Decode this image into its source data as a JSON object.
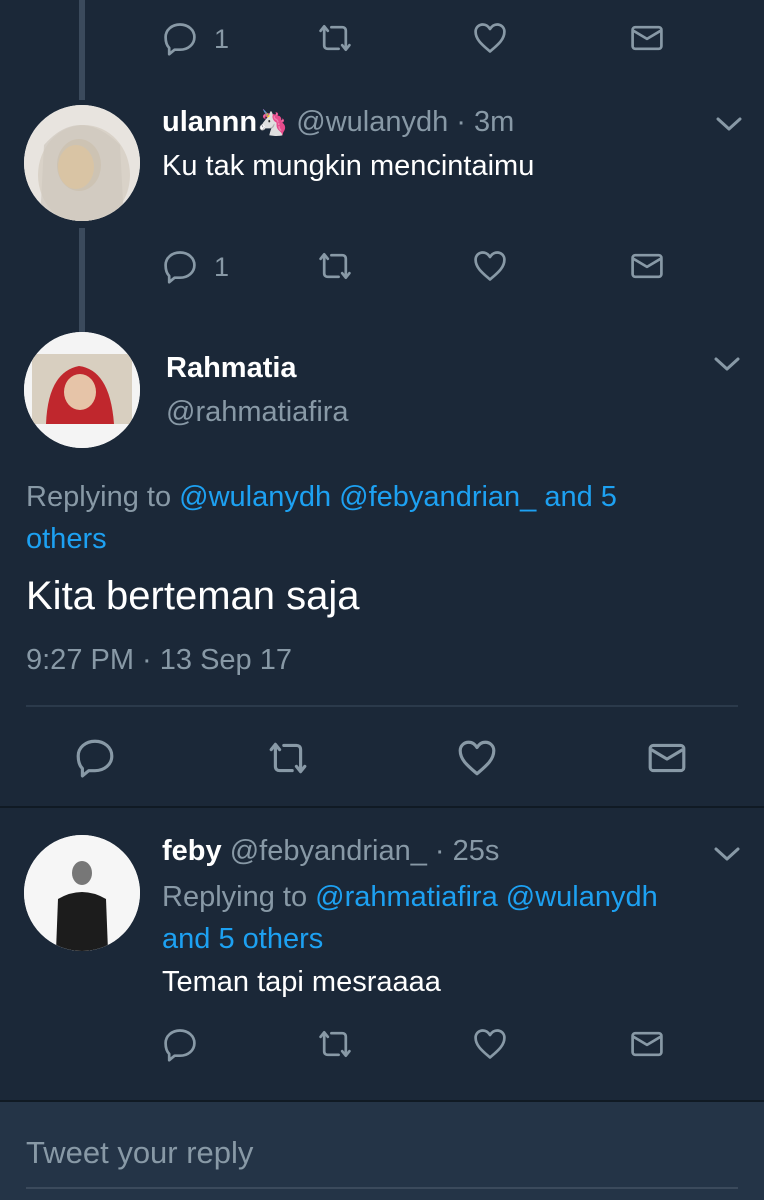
{
  "colors": {
    "background": "#1b2838",
    "accent": "#1da1f2",
    "muted": "#8899a6",
    "text": "#ffffff"
  },
  "tweet0": {
    "reply_count": "1"
  },
  "tweet1": {
    "name": "ulannn",
    "name_emoji": "🦄",
    "handle": "@wulanydh",
    "time": "· 3m",
    "text": "Ku tak mungkin mencintaimu",
    "reply_count": "1"
  },
  "main": {
    "name": "Rahmatia",
    "handle": "@rahmatiafira",
    "replying_prefix": "Replying to",
    "replying_mentions": "@wulanydh @febyandrian_ and 5",
    "replying_others": "others",
    "text": "Kita berteman saja",
    "timestamp": "9:27 PM · 13 Sep 17"
  },
  "tweet3": {
    "name": "feby",
    "handle": "@febyandrian_",
    "time": "· 25s",
    "replying_prefix": "Replying to",
    "replying_mentions": "@rahmatiafira @wulanydh",
    "replying_others": "and 5 others",
    "text": "Teman tapi mesraaaa"
  },
  "reply_box": {
    "placeholder": "Tweet your reply"
  },
  "icons": [
    "reply-icon",
    "retweet-icon",
    "like-icon",
    "message-icon",
    "chevron-down-icon"
  ]
}
